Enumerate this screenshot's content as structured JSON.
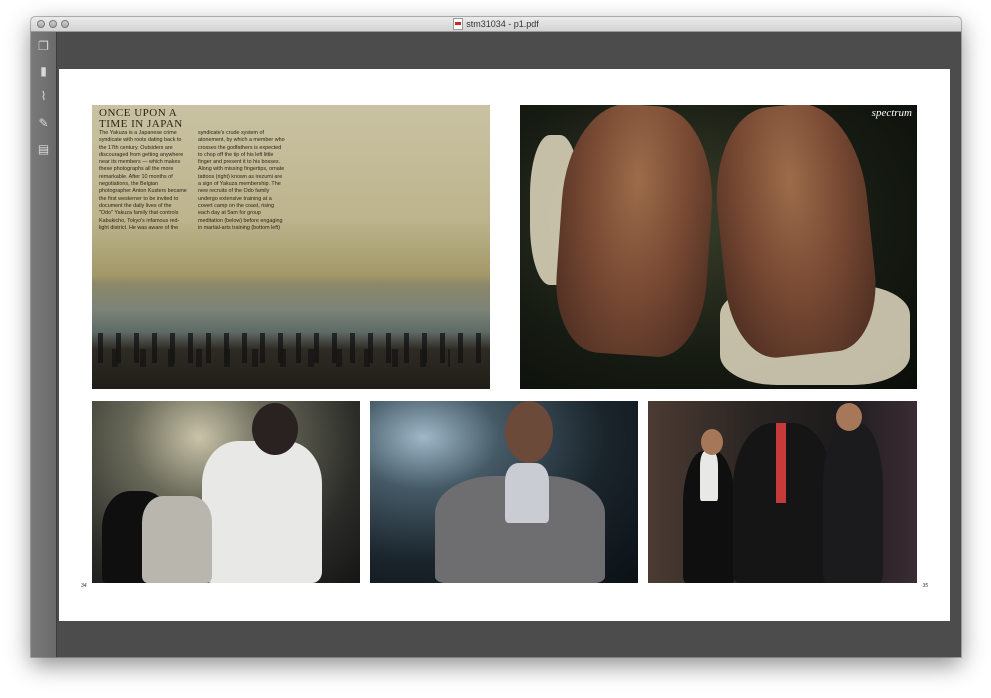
{
  "window": {
    "title": "stm31034 - p1.pdf"
  },
  "sidebar": {
    "icons": [
      {
        "name": "pages-icon",
        "glyph": "❐"
      },
      {
        "name": "bookmark-icon",
        "glyph": "▮"
      },
      {
        "name": "attachment-icon",
        "glyph": "⌇"
      },
      {
        "name": "signature-icon",
        "glyph": "✎"
      },
      {
        "name": "security-icon",
        "glyph": "▤"
      }
    ]
  },
  "spread": {
    "heading_line1": "ONCE UPON A",
    "heading_line2": "TIME IN JAPAN",
    "column1": "The Yakuza is a Japanese crime syndicate with roots dating back to the 17th century. Outsiders are discouraged from getting anywhere near its members — which makes these photographs all the more remarkable. After 10 months of negotiations, the Belgian photographer Anton Kusters became the first westerner to be invited to document the daily lives of the \"Odo\" Yakuza family that controls Kabukicho, Tokyo's infamous red-light district. He was aware of the",
    "column2": "syndicate's crude system of atonement, by which a member who crosses the godfathers is expected to chop off the tip of his left little finger and present it to his bosses. Along with missing fingertips, ornate tattoos (right) known as irezumi are a sign of Yakuza membership. The new recruits of the Odo family undergo extensive training at a covert camp on the coast, rising each day at 5am for group meditation (below) before engaging in martial-arts training (bottom left)",
    "magazine_label": "spectrum",
    "page_left": "34",
    "page_right": "35"
  }
}
